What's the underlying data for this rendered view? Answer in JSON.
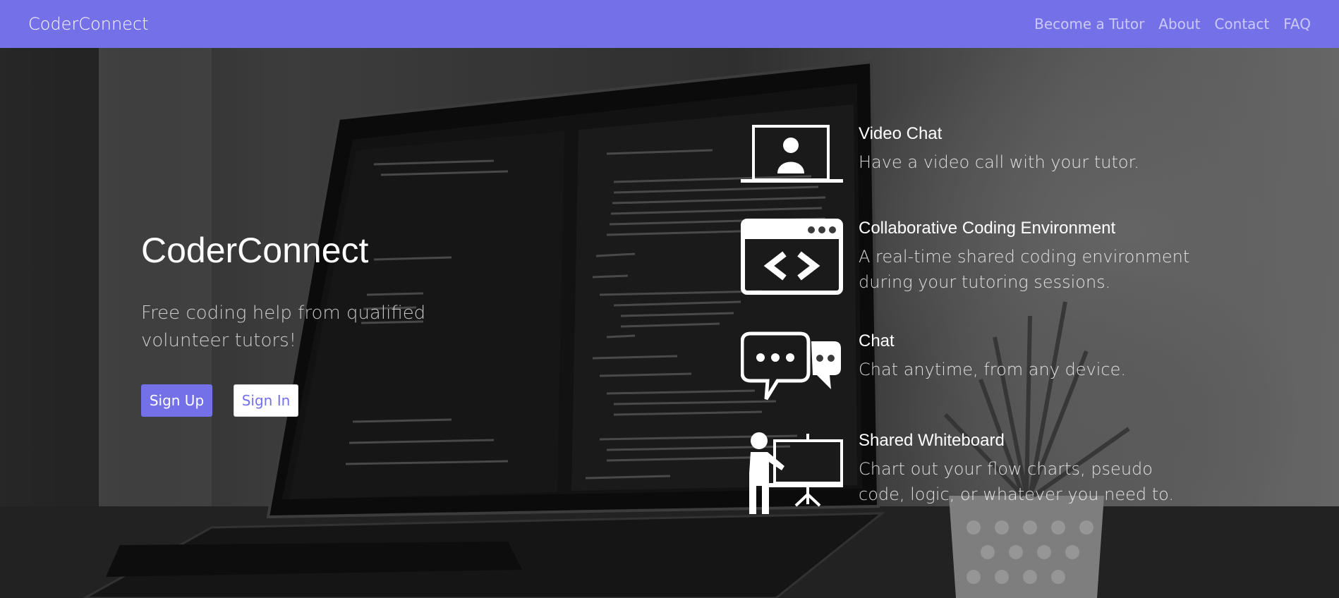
{
  "navbar": {
    "brand": "CoderConnect",
    "links": [
      "Become a Tutor",
      "About",
      "Contact",
      "FAQ"
    ],
    "background_color": "#7471e8"
  },
  "hero": {
    "title": "CoderConnect",
    "subtitle": "Free coding help from qualified volunteer tutors!",
    "signup_label": "Sign Up",
    "signin_label": "Sign In",
    "accent_color": "#7471e8"
  },
  "features": [
    {
      "icon": "laptop-user-icon",
      "title": "Video Chat",
      "description": "Have a video call with your tutor."
    },
    {
      "icon": "code-window-icon",
      "title": "Collaborative Coding Environment",
      "description": "A real-time shared coding environment during your tutoring sessions."
    },
    {
      "icon": "chat-bubbles-icon",
      "title": "Chat",
      "description": "Chat anytime, from any device."
    },
    {
      "icon": "presentation-board-icon",
      "title": "Shared Whiteboard",
      "description": "Chart out your flow charts, pseudo code, logic, or whatever you need to."
    }
  ]
}
